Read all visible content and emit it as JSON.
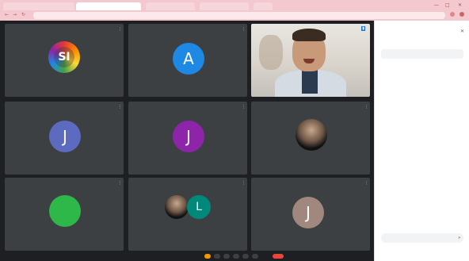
{
  "browser": {
    "tabs": [
      "",
      "",
      "",
      "",
      ""
    ],
    "address": "",
    "win_controls": [
      "—",
      "□",
      "✕"
    ]
  },
  "meeting": {
    "tiles": [
      {
        "name": "",
        "avatar_text": "SI",
        "avatar_kind": "multicolor"
      },
      {
        "name": "",
        "avatar_text": "A",
        "avatar_color": "#1e88e5"
      },
      {
        "name": "",
        "avatar_text": "",
        "avatar_kind": "video"
      },
      {
        "name": "",
        "avatar_text": "J",
        "avatar_color": "#5c6bc0"
      },
      {
        "name": "",
        "avatar_text": "J",
        "avatar_color": "#8e24aa"
      },
      {
        "name": "",
        "avatar_text": "",
        "avatar_kind": "photo"
      },
      {
        "name": "",
        "avatar_text": "",
        "avatar_color": "#2eb84a"
      },
      {
        "name": "",
        "avatar_text": "L",
        "avatar_color": "#00897b",
        "avatar_kind": "group"
      },
      {
        "name": "",
        "avatar_text": "J",
        "avatar_color": "#a1887f"
      }
    ]
  },
  "chat_panel": {
    "title": "",
    "close": "✕",
    "note": "",
    "messages": [
      {
        "sender": "",
        "text": ""
      },
      {
        "sender": "",
        "text": ""
      },
      {
        "sender": "",
        "text": ""
      },
      {
        "sender": "",
        "text": ""
      },
      {
        "sender": "",
        "text": ""
      },
      {
        "sender": "",
        "text": ""
      }
    ],
    "input_placeholder": ""
  },
  "colors": {
    "stage_bg": "#1e1f22",
    "tile_bg": "#3c4043",
    "chrome_bg": "#f3c9cf",
    "link": "#1a73e8",
    "end_call": "#e8453c"
  }
}
